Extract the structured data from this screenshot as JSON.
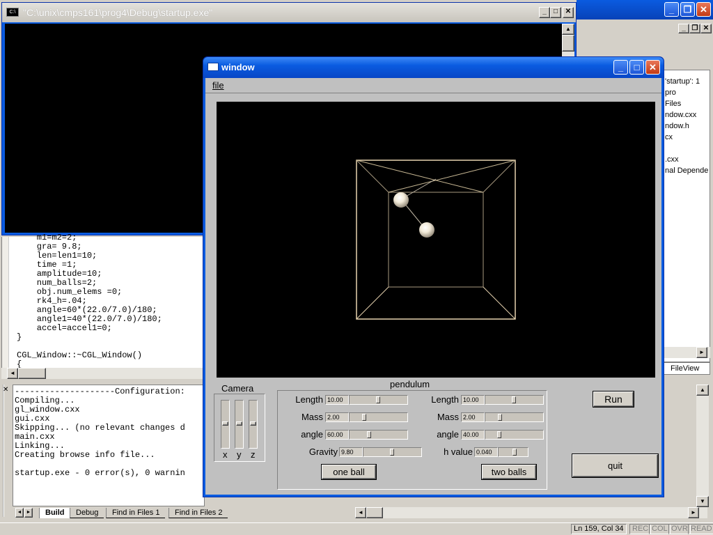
{
  "console": {
    "title": "\"C:\\unix\\cmps161\\prog4\\Debug\\startup.exe\"",
    "icon": "console-icon"
  },
  "editor": {
    "lines": [
      "    m1=m2=2;",
      "    gra= 9.8;",
      "    len=len1=10;",
      "    time =1;",
      "    amplitude=10;",
      "    num_balls=2;",
      "    obj.num_elems =0;",
      "    rk4_h=.04;",
      "    angle=60*(22.0/7.0)/180;",
      "    angle1=40*(22.0/7.0)/180;",
      "    accel=accel1=0;",
      "}",
      "",
      "CGL_Window::~CGL_Window()",
      "{"
    ]
  },
  "output": {
    "lines": [
      "--------------------Configuration:",
      "Compiling...",
      "gl_window.cxx",
      "gui.cxx",
      "Skipping... (no relevant changes d",
      "main.cxx",
      "Linking...",
      "Creating browse info file...",
      "",
      "startup.exe - 0 error(s), 0 warnin"
    ],
    "tabs": [
      "Build",
      "Debug",
      "Find in Files 1",
      "Find in Files 2"
    ]
  },
  "workspace": {
    "lines": [
      "'startup': 1 pro",
      "Files",
      "ndow.cxx",
      "ndow.h",
      "cx",
      "",
      ".cxx",
      "nal Depende"
    ],
    "tab": "FileView"
  },
  "status": {
    "position": "Ln 159, Col 34",
    "indicators": [
      "REC",
      "COL",
      "OVR",
      "READ"
    ]
  },
  "app": {
    "title": "window",
    "menu": [
      "file"
    ],
    "camera": {
      "label": "Camera",
      "axes": [
        "x",
        "y",
        "z"
      ]
    },
    "group_title": "pendulum",
    "left": {
      "length_label": "Length",
      "length_value": "10.00",
      "length_frac": 0.5,
      "mass_label": "Mass",
      "mass_value": "2.00",
      "mass_frac": 0.24,
      "angle_label": "angle",
      "angle_value": "60.00",
      "angle_frac": 0.33
    },
    "right": {
      "length_label": "Length",
      "length_value": "10.00",
      "length_frac": 0.5,
      "mass_label": "Mass",
      "mass_value": "2.00",
      "mass_frac": 0.24,
      "angle_label": "angle",
      "angle_value": "40.00",
      "angle_frac": 0.22
    },
    "gravity": {
      "label": "Gravity",
      "value": "9.80",
      "frac": 0.5
    },
    "hvalue": {
      "label": "h value",
      "value": "0.040",
      "frac": 0.6
    },
    "buttons": {
      "one_ball": "one ball",
      "two_balls": "two balls",
      "run": "Run",
      "quit": "quit"
    }
  },
  "colors": {
    "titlebar": "#0a5be0",
    "box_line": "#e8d4b0",
    "ball": "#f2ead8"
  }
}
